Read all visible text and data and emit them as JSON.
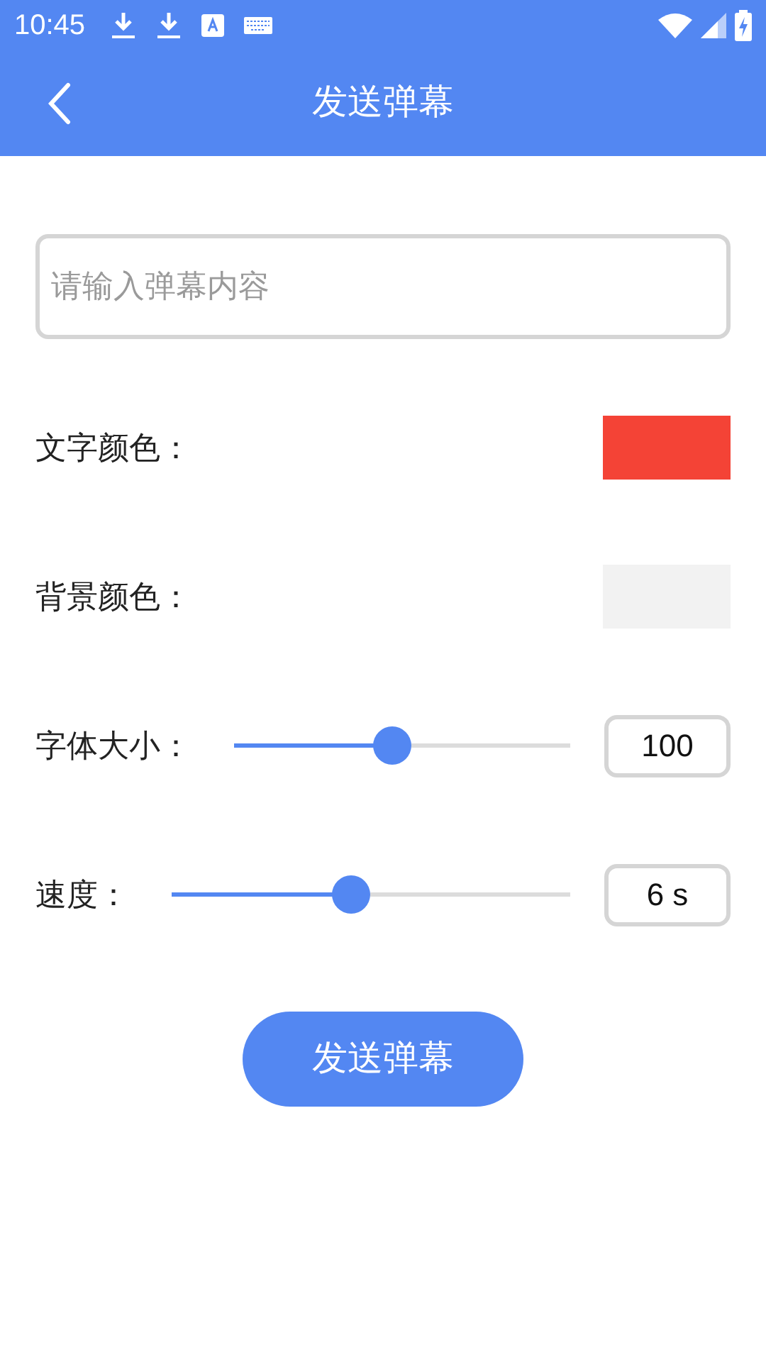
{
  "status_bar": {
    "time": "10:45"
  },
  "app_bar": {
    "title": "发送弹幕"
  },
  "input": {
    "placeholder": "请输入弹幕内容"
  },
  "settings": [
    {
      "kind": "color",
      "label": "文字颜色：",
      "color": "#f44336"
    },
    {
      "kind": "color",
      "label": "背景颜色：",
      "color": "#f2f2f2"
    },
    {
      "kind": "slider",
      "label": "字体大小：",
      "level": 0.47,
      "value": "100"
    },
    {
      "kind": "slider",
      "label": "速度：",
      "level": 0.45,
      "value": "6 s"
    }
  ],
  "send_button": {
    "label": "发送弹幕"
  }
}
